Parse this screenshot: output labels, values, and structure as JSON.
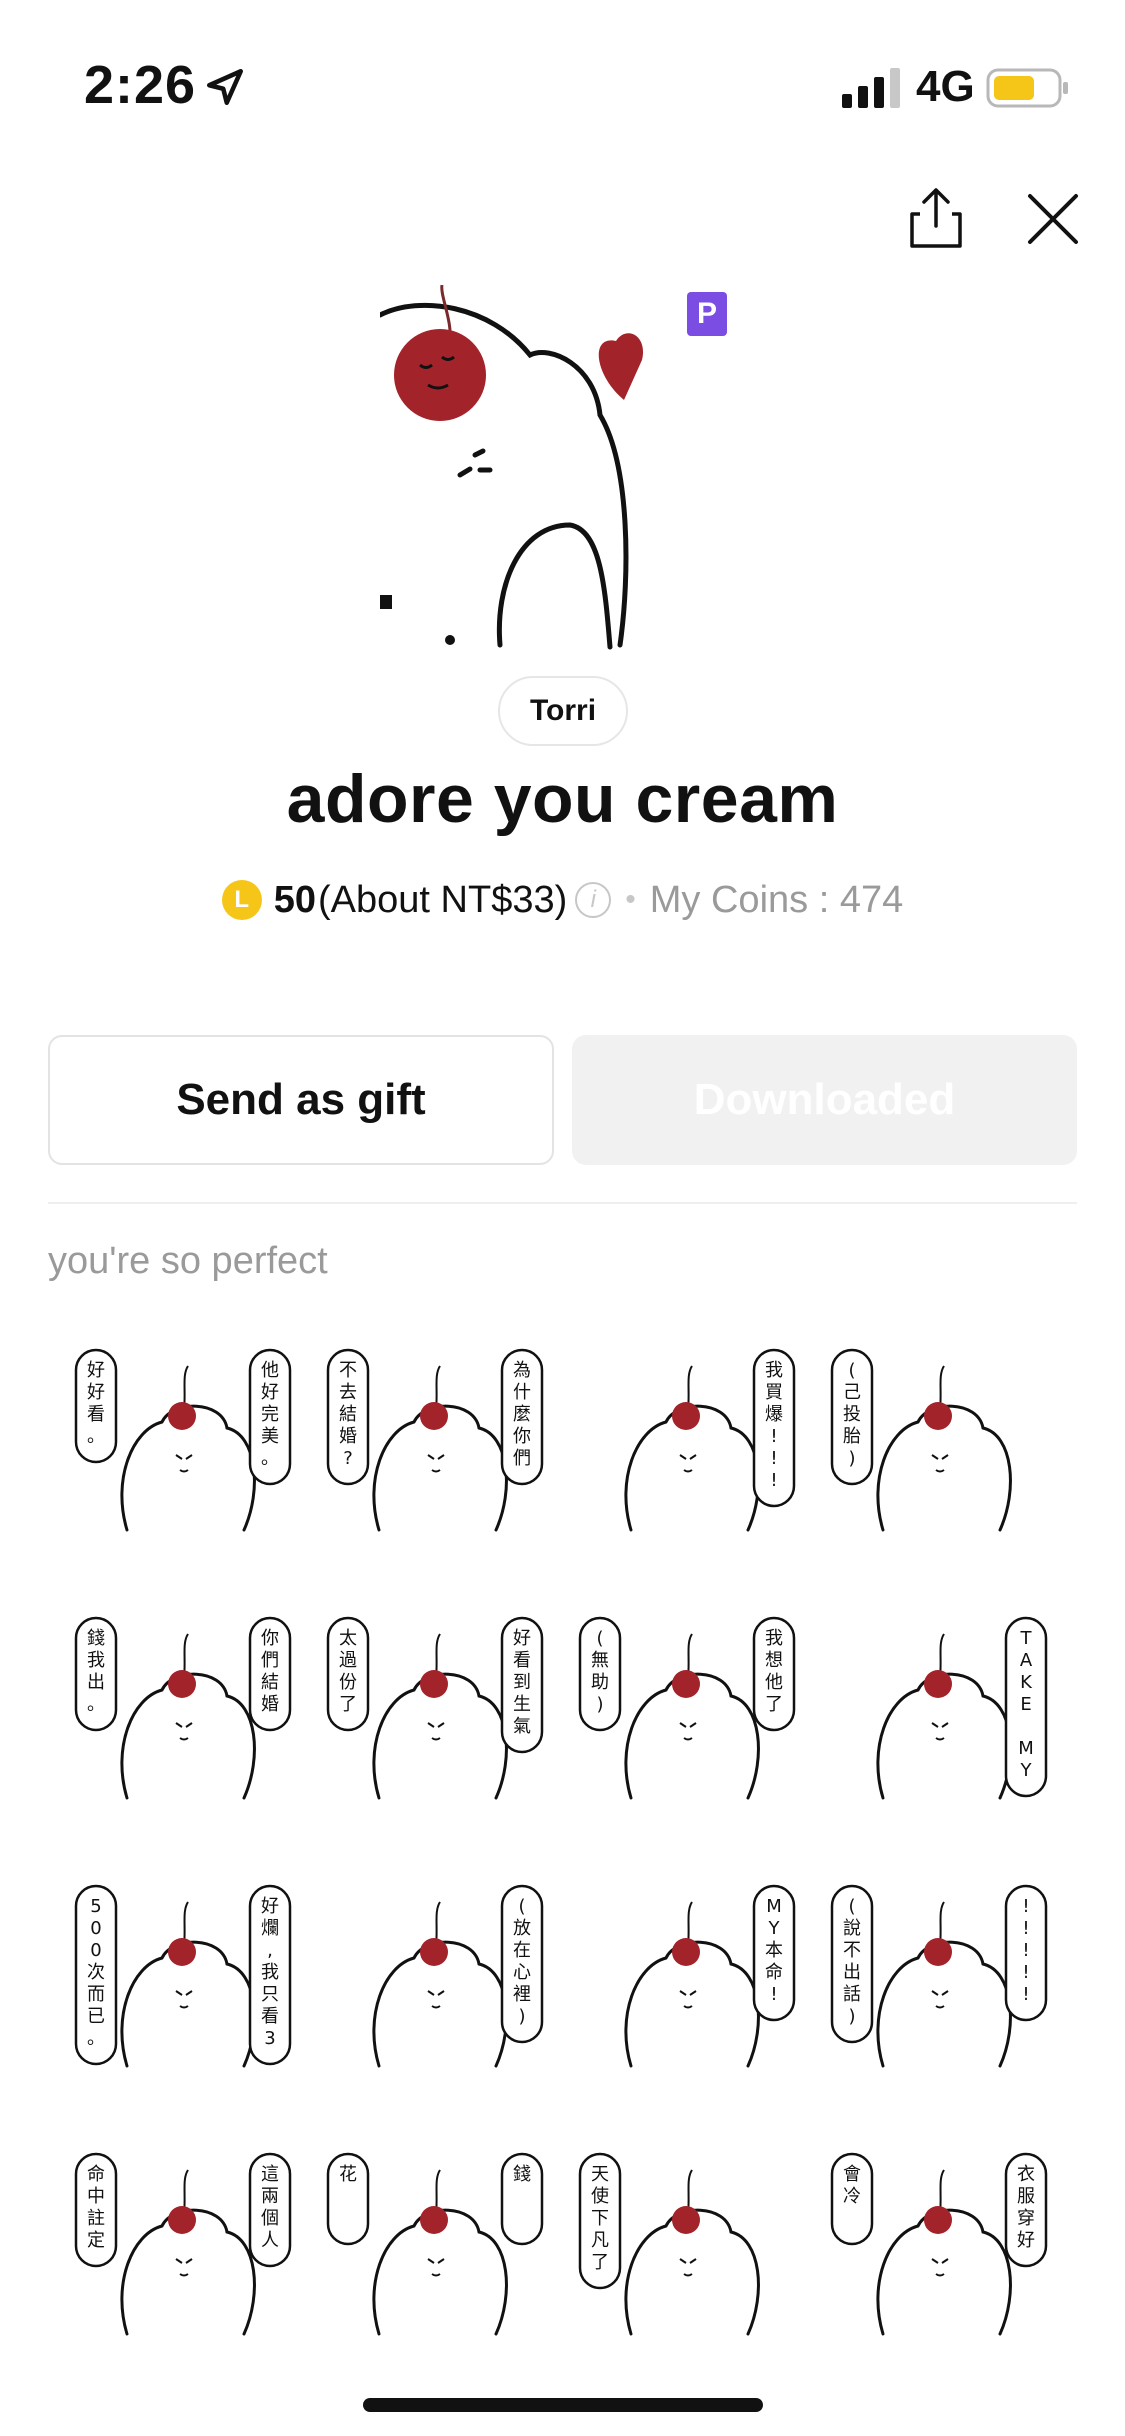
{
  "status_bar": {
    "time": "2:26",
    "network": "4G",
    "icons": [
      "location-arrow-icon",
      "signal-icon",
      "battery-icon"
    ]
  },
  "header": {
    "icons": [
      "share-icon",
      "close-icon"
    ],
    "badge": "P"
  },
  "sticker_pack": {
    "author": "Torri",
    "title": "adore you cream",
    "coin_symbol": "L",
    "price": "50",
    "price_approx": "(About NT$33)",
    "info_icon": "i",
    "separator": "•",
    "my_coins": "My Coins : 474"
  },
  "actions": {
    "gift_label": "Send as gift",
    "download_label": "Downloaded"
  },
  "preview": {
    "section_title": "you're so perfect",
    "stickers": [
      {
        "text_left": "好好看。",
        "text_right": "他好完美。"
      },
      {
        "text_left": "不去結婚?",
        "text_right": "為什麼你們"
      },
      {
        "text_left": "",
        "text_right": "我買爆!!!"
      },
      {
        "text_left": "(己投胎)",
        "text_right": ""
      },
      {
        "text_left": "錢我出。",
        "text_right": "你們結婚"
      },
      {
        "text_left": "太過份了",
        "text_right": "好看到生氣"
      },
      {
        "text_left": "(無助)",
        "text_right": "我想他了"
      },
      {
        "text_left": "",
        "text_right": "TAKE MY MONEY"
      },
      {
        "text_left": "500次而已。",
        "text_right": "好爛,我只看3"
      },
      {
        "text_left": "",
        "text_right": "(放在心裡)"
      },
      {
        "text_left": "",
        "text_right": "MY本命!"
      },
      {
        "text_left": "(說不出話)",
        "text_right": "!!!!!"
      },
      {
        "text_left": "命中註定",
        "text_right": "這兩個人"
      },
      {
        "text_left": "花",
        "text_right": "錢"
      },
      {
        "text_left": "天使下凡了",
        "text_right": ""
      },
      {
        "text_left": "會冷",
        "text_right": "衣服穿好"
      }
    ]
  },
  "colors": {
    "accent_premium": "#7b4de3",
    "coin": "#f5c518",
    "cherry": "#a3232b",
    "disabled_button": "#f1f1f1"
  }
}
